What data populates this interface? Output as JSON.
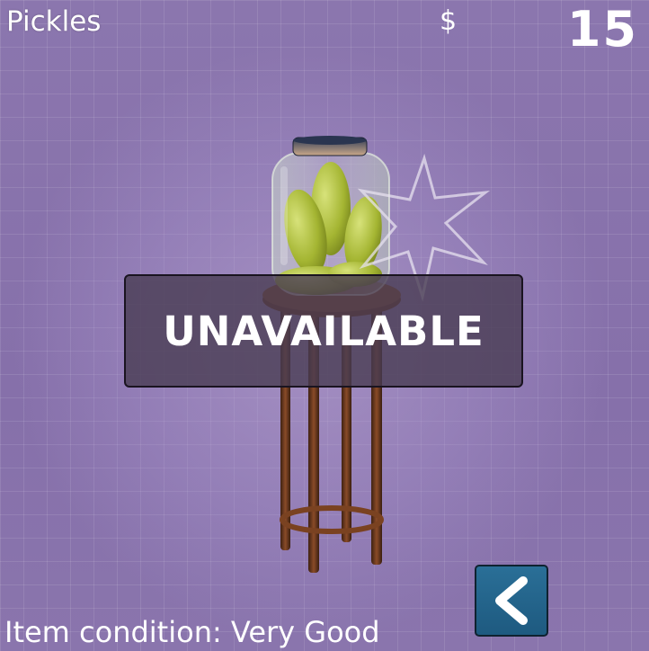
{
  "header": {
    "item_name": "Pickles",
    "currency_symbol": "$",
    "money": "15"
  },
  "item": {
    "name": "Pickles",
    "status_label": "UNAVAILABLE",
    "condition_label": "Item condition:",
    "condition_value": "Very Good"
  },
  "icons": {
    "back": "chevron-left-icon",
    "sparkle": "star-sparkle-icon"
  },
  "colors": {
    "background": "#8a74ac",
    "banner": "#483c52",
    "back_button": "#2a6f97",
    "text": "#ffffff"
  }
}
